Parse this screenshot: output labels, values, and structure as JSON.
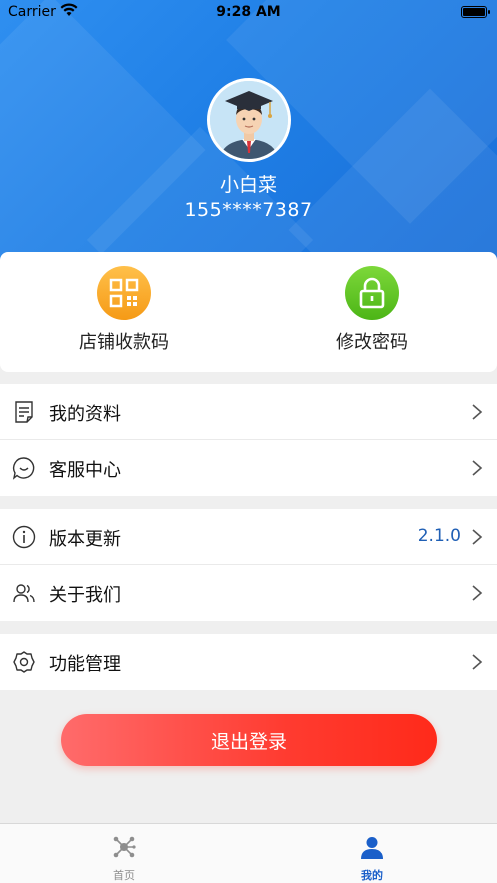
{
  "status_bar": {
    "carrier": "Carrier",
    "time": "9:28 AM"
  },
  "profile": {
    "name": "小白菜",
    "phone": "155****7387"
  },
  "quick_actions": [
    {
      "label": "店铺收款码",
      "icon": "qr-code-icon",
      "color": "#f7a021"
    },
    {
      "label": "修改密码",
      "icon": "lock-icon",
      "color": "#5cc21c"
    }
  ],
  "menu_groups": [
    [
      {
        "label": "我的资料",
        "icon": "document-edit-icon"
      },
      {
        "label": "客服中心",
        "icon": "chat-bubble-icon"
      }
    ],
    [
      {
        "label": "版本更新",
        "icon": "info-icon",
        "value": "2.1.0"
      },
      {
        "label": "关于我们",
        "icon": "users-icon"
      }
    ],
    [
      {
        "label": "功能管理",
        "icon": "settings-gear-icon"
      }
    ]
  ],
  "logout_label": "退出登录",
  "tabs": [
    {
      "label": "首页",
      "icon": "hub-icon",
      "active": false
    },
    {
      "label": "我的",
      "icon": "person-icon",
      "active": true
    }
  ],
  "colors": {
    "header": "#2f8ff0",
    "active_tab": "#1a5fc9",
    "inactive_tab": "#8e8e8e",
    "version": "#1f5fb5"
  }
}
